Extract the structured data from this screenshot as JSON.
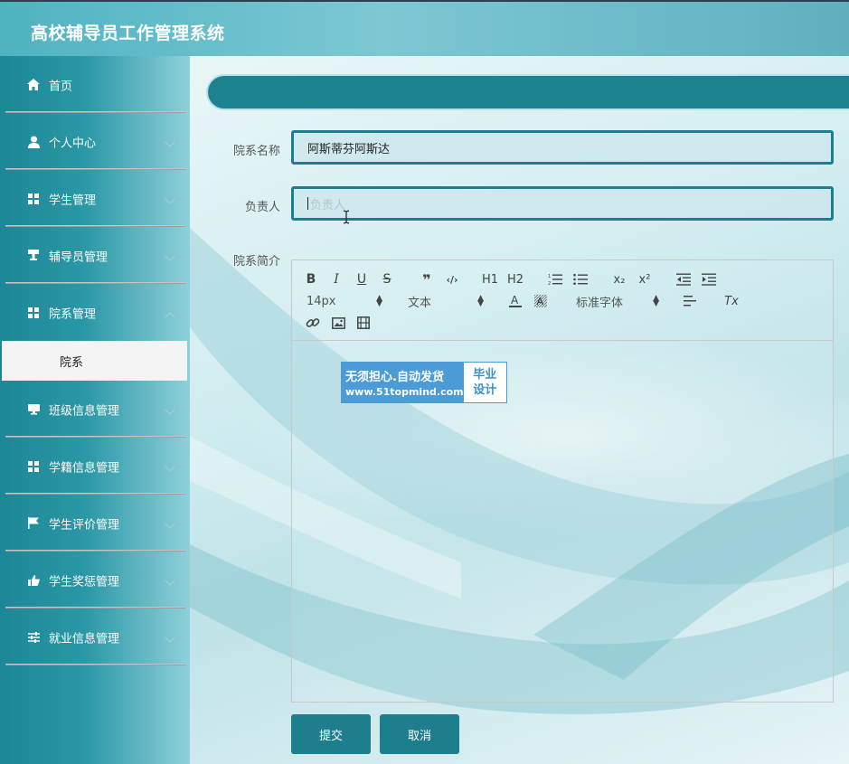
{
  "app": {
    "title": "高校辅导员工作管理系统"
  },
  "sidebar": {
    "items": [
      {
        "label": "首页",
        "icon": "home-icon",
        "has_children": false
      },
      {
        "label": "个人中心",
        "icon": "user-icon",
        "has_children": true
      },
      {
        "label": "学生管理",
        "icon": "grid-icon",
        "has_children": true
      },
      {
        "label": "辅导员管理",
        "icon": "podium-icon",
        "has_children": true
      },
      {
        "label": "院系管理",
        "icon": "grid-icon",
        "has_children": true,
        "expanded": true
      },
      {
        "label": "班级信息管理",
        "icon": "monitor-icon",
        "has_children": true
      },
      {
        "label": "学籍信息管理",
        "icon": "grid-icon",
        "has_children": true
      },
      {
        "label": "学生评价管理",
        "icon": "flag-icon",
        "has_children": true
      },
      {
        "label": "学生奖惩管理",
        "icon": "thumbs-up-icon",
        "has_children": true
      },
      {
        "label": "就业信息管理",
        "icon": "sliders-icon",
        "has_children": true
      }
    ],
    "subitem": {
      "label": "院系"
    }
  },
  "form": {
    "dept_name": {
      "label": "院系名称",
      "value": "阿斯蒂芬阿斯达"
    },
    "leader": {
      "label": "负责人",
      "placeholder": "负责人",
      "value": ""
    },
    "intro": {
      "label": "院系简介"
    },
    "submit_label": "提交",
    "cancel_label": "取消"
  },
  "editor": {
    "font_size": "14px",
    "block_type": "文本",
    "font_family": "标准字体",
    "buttons": {
      "bold": "B",
      "italic": "I",
      "underline": "U",
      "strike": "S",
      "quote": "❞",
      "code": "‹/›",
      "h1": "H1",
      "h2": "H2",
      "sub": "x₂",
      "sup": "x²",
      "clear": "Tx"
    }
  },
  "watermark": {
    "line1": "无须担心.自动发货",
    "line2": "www.51topmind.com",
    "right_line1": "毕业",
    "right_line2": "设计"
  },
  "colors": {
    "primary": "#1d7f8d",
    "header": "#6cc1cd",
    "sidebar": "#2a98a6",
    "watermark_blue": "#4a9bd6"
  }
}
